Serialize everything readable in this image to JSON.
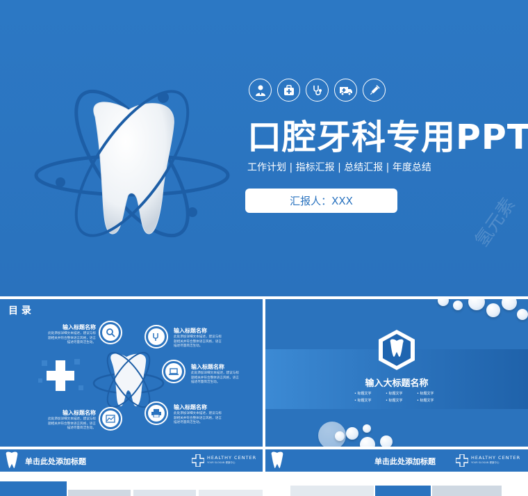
{
  "main": {
    "title": "口腔牙科专用PPT",
    "subtitle": "工作计划 | 指标汇报 | 总结汇报 | 年度总结",
    "reporter": "汇报人：XXX",
    "watermark": "氢元素",
    "icons": [
      "doctor-icon",
      "medical-kit-icon",
      "stethoscope-icon",
      "ambulance-icon",
      "syringe-icon"
    ]
  },
  "toc": {
    "title": "目 录",
    "items": [
      {
        "title": "输入标题名称",
        "desc": "此处添加详细文本描述，建议与标题相关并符合整体语言风格，语言描述尽量简洁生动。",
        "icon": "search-icon"
      },
      {
        "title": "输入标题名称",
        "desc": "此处添加详细文本描述，建议与标题相关并符合整体语言风格，语言描述尽量简洁生动。",
        "icon": "tooth-tool-icon"
      },
      {
        "title": "输入标题名称",
        "desc": "此处添加详细文本描述，建议与标题相关并符合整体语言风格，语言描述尽量简洁生动。",
        "icon": "laptop-icon"
      },
      {
        "title": "输入标题名称",
        "desc": "此处添加详细文本描述，建议与标题相关并符合整体语言风格，语言描述尽量简洁生动。",
        "icon": "chart-icon"
      },
      {
        "title": "输入标题名称",
        "desc": "此处添加详细文本描述，建议与标题相关并符合整体语言风格，语言描述尽量简洁生动。",
        "icon": "printer-icon"
      }
    ]
  },
  "section": {
    "title": "输入大标题名称",
    "labels": [
      "标题文字",
      "标题文字",
      "标题文字",
      "标题文字",
      "标题文字",
      "标题文字"
    ],
    "icon": "tooth-icon"
  },
  "bottom_left": {
    "title": "单击此处添加标题",
    "brand": "HEALTHY CENTER",
    "brand_sub": "YOUR SLOGAN 健康中心"
  },
  "bottom_right": {
    "title": "单击此处添加标题",
    "brand": "HEALTHY CENTER",
    "brand_sub": "YOUR SLOGAN 健康中心"
  },
  "colors": {
    "primary": "#2a73bf",
    "white": "#ffffff",
    "dark": "#1a5a9e"
  }
}
